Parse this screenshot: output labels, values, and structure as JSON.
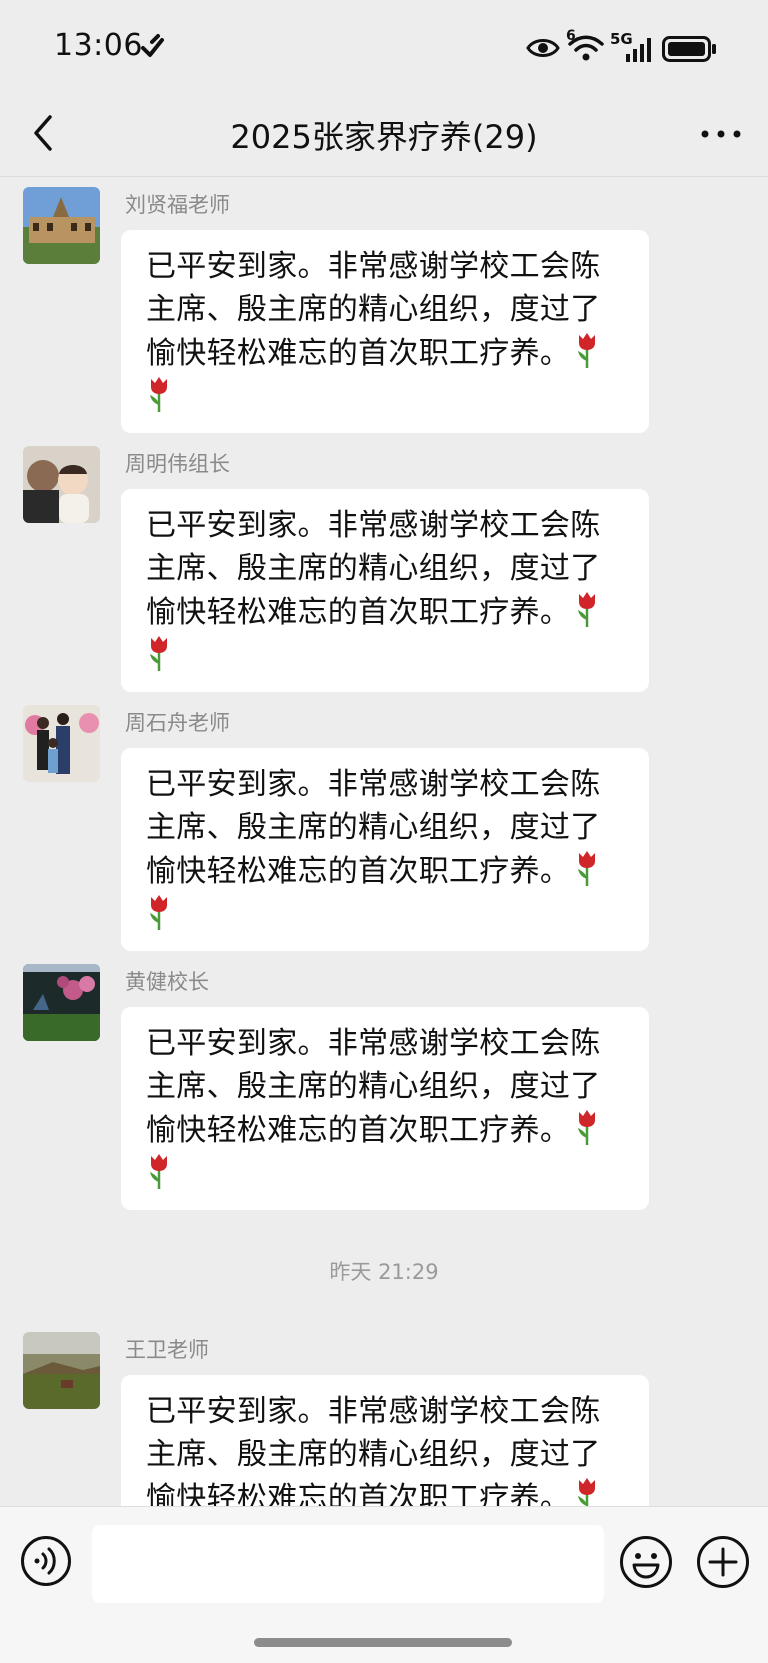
{
  "status_bar": {
    "time": "13:06",
    "network_label": "5G",
    "wifi_label": "6"
  },
  "header": {
    "title": "2025张家界疗养(29)",
    "back_icon": "chevron-left-icon",
    "more_icon": "more-dots-icon"
  },
  "messages": [
    {
      "sender": "刘贤福老师",
      "text": "已平安到家。非常感谢学校工会陈主席、殷主席的精心组织，度过了愉快轻松难忘的首次职工疗养。",
      "emoji": [
        "tulip",
        "tulip"
      ]
    },
    {
      "sender": "周明伟组长",
      "text": "已平安到家。非常感谢学校工会陈主席、殷主席的精心组织，度过了愉快轻松难忘的首次职工疗养。",
      "emoji": [
        "tulip",
        "tulip"
      ]
    },
    {
      "sender": "周石舟老师",
      "text": "已平安到家。非常感谢学校工会陈主席、殷主席的精心组织，度过了愉快轻松难忘的首次职工疗养。",
      "emoji": [
        "tulip",
        "tulip"
      ]
    },
    {
      "sender": "黄健校长",
      "text": "已平安到家。非常感谢学校工会陈主席、殷主席的精心组织，度过了愉快轻松难忘的首次职工疗养。",
      "emoji": [
        "tulip",
        "tulip"
      ]
    },
    {
      "sender": "王卫老师",
      "text": "已平安到家。非常感谢学校工会陈主席、殷主席的精心组织，度过了愉快轻松难忘的首次职工疗养。",
      "emoji": [
        "tulip"
      ]
    }
  ],
  "time_divider": "昨天 21:29",
  "input_bar": {
    "input_value": "",
    "voice_icon": "voice-icon",
    "emoji_icon": "smiley-icon",
    "plus_icon": "plus-circle-icon"
  },
  "colors": {
    "background": "#ededed",
    "bubble": "#ffffff",
    "sender_name": "#8a8a8a",
    "tulip_red": "#d0262a",
    "tulip_green": "#4a9a3a"
  }
}
